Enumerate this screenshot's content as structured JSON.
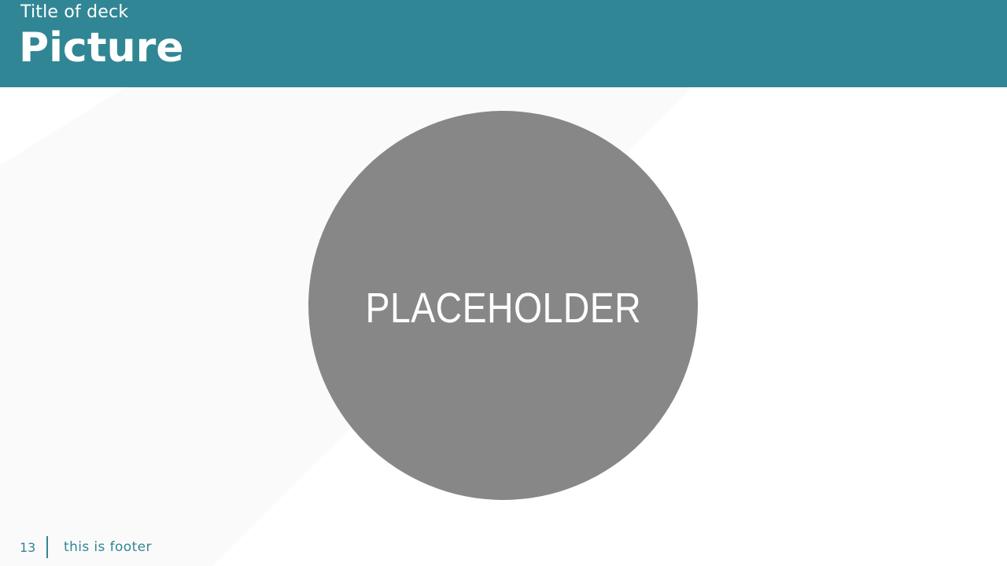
{
  "header": {
    "deck_title": "Title of deck",
    "page_title": "Picture"
  },
  "content": {
    "placeholder_label": "PLACEHOLDER"
  },
  "footer": {
    "page_number": "13",
    "text": "this is footer"
  },
  "colors": {
    "accent": "#318695",
    "placeholder_fill": "#878787",
    "background": "#ffffff"
  }
}
